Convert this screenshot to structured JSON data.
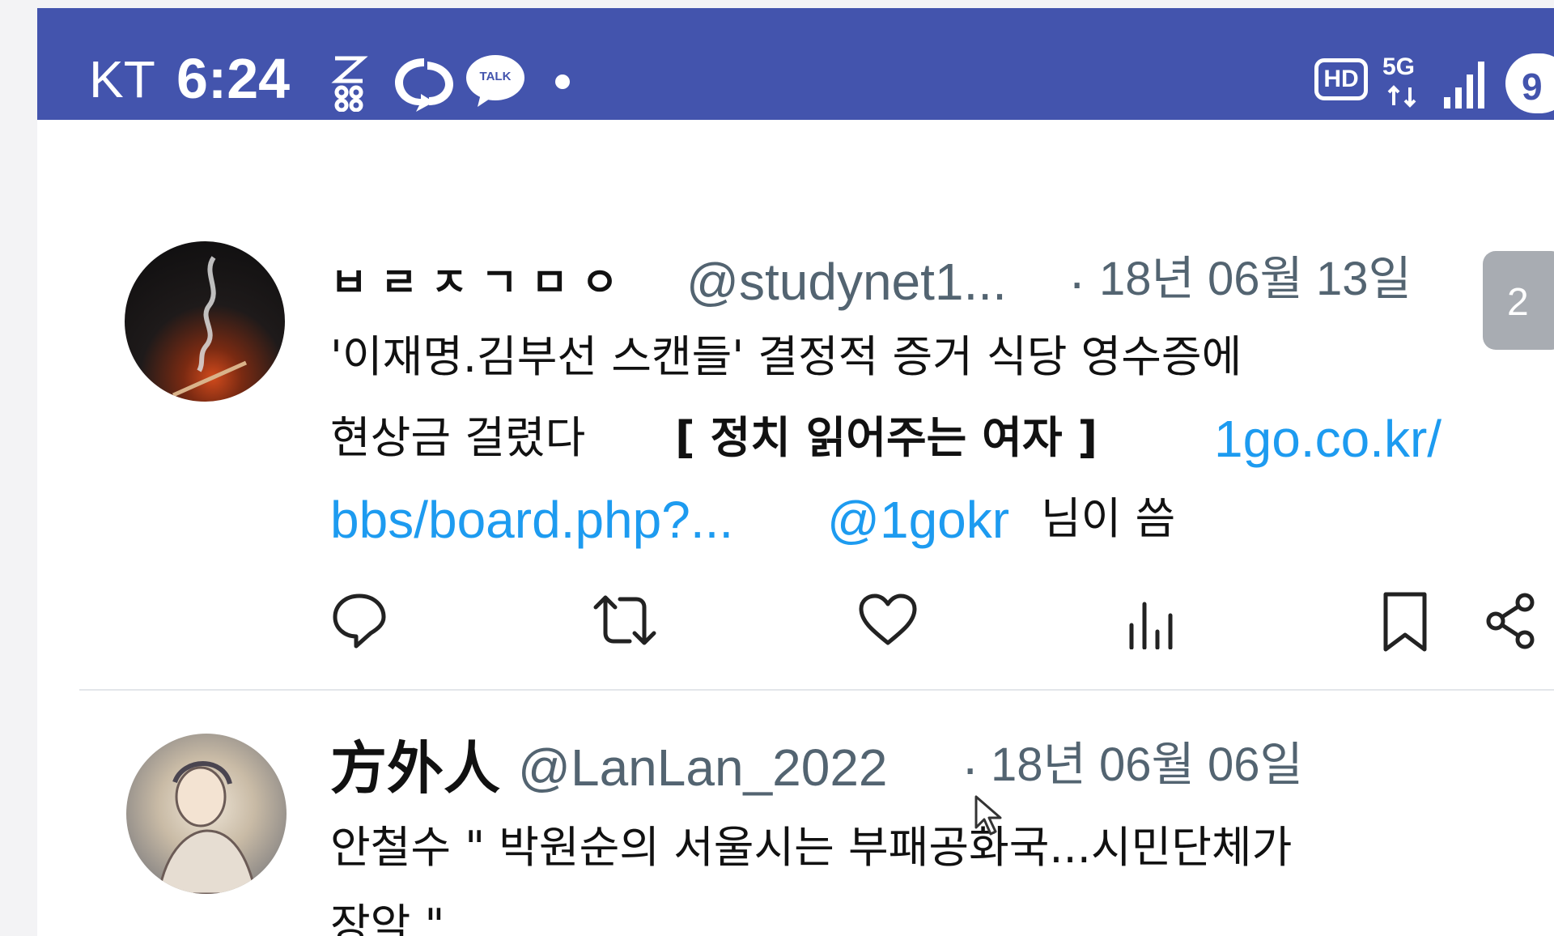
{
  "status_bar": {
    "carrier": "KT",
    "time": "6:24",
    "icons_left": [
      "app-icon",
      "sync-icon",
      "kakaotalk-icon",
      "notification-dot-icon"
    ],
    "talk_label": "TALK",
    "icons_right": [
      "hd-voice-icon",
      "5g-icon",
      "signal-icon",
      "battery-icon"
    ],
    "hd_label": "HD",
    "network_label": "5G",
    "battery_level": "9",
    "bar_color": "#4354ad"
  },
  "tweets": [
    {
      "display_name": "ㅂㄹㅈㄱㅁㅇ",
      "handle": "@studynet1...",
      "separator": "·",
      "date": "18년 06월 13일",
      "text_line1": "'이재명.김부선 스캔들' 결정적 증거 식당 영수증에",
      "text_line2_a": "현상금 걸렸다 ",
      "text_line2_b": "[ 정치 읽어주는 여자 ]",
      "link_part1": "1go.co.kr/",
      "link_part2": "bbs/board.php?...",
      "mention": "@1gokr",
      "text_tail": "님이 씀",
      "actions": [
        "reply-icon",
        "retweet-icon",
        "like-icon",
        "views-icon",
        "bookmark-icon",
        "share-icon"
      ]
    },
    {
      "display_name": "方外人",
      "handle": "@LanLan_2022",
      "separator": "·",
      "date": "18년 06월 06일",
      "text_line1": "안철수 \" 박원순의 서울시는 부패공화국...시민단체가",
      "text_line2": "장악 \""
    }
  ],
  "overlay_badge": "2",
  "link_color": "#1d9bf0"
}
